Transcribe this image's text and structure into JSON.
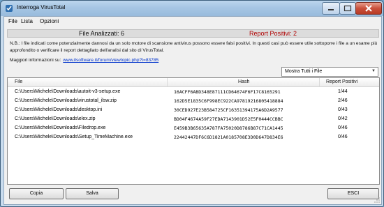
{
  "window": {
    "title": "Interroga VirusTotal"
  },
  "menu": [
    "File",
    "Lista",
    "Opzioni"
  ],
  "summary": {
    "analyzed": "File Analizzati: 6",
    "positive": "Report Positivi: 2"
  },
  "note": "N.B.: I file indicati come potenzialmente dannosi da un solo motore di scansione antivirus possono essere falsi positivi. In questi casi può essere utile sottoporre i file a un esame più approfondito o verificare il report dettagliato dell'analisi dal sito di VirusTotal.",
  "more_info": {
    "label": "Maggiori informazioni su:",
    "link": "www.ilsoftware.it/forum/viewtopic.php?t=83785"
  },
  "filter": {
    "selected": "Mostra Tutti i File"
  },
  "table": {
    "headers": [
      "File",
      "Hash",
      "Report Positivi"
    ],
    "rows": [
      {
        "file": "C:\\Users\\Michele\\Downloads\\autoit-v3-setup.exe",
        "hash": "16ACFF6ABD348E87111CD64674F6F17C8165291",
        "report": "1/44"
      },
      {
        "file": "C:\\Users\\Michele\\Downloads\\virustotal_ilsw.zip",
        "hash": "162D5E1835C6F998EC922CA97819216805418884",
        "report": "2/46"
      },
      {
        "file": "C:\\Users\\Michele\\Downloads\\desktop.ini",
        "hash": "30CED927E23B584725CF16351394175A6D2A9577",
        "report": "0/43"
      },
      {
        "file": "C:\\Users\\Michele\\Downloads\\elex.zip",
        "hash": "BD04F4674A59F27EDA7143901D52E5F0444CCBBC",
        "report": "0/42"
      },
      {
        "file": "C:\\Users\\Michele\\Downloads\\Filedrop.exe",
        "hash": "E459B3B65635A787FA75020D8786B87C71CA1445",
        "report": "0/46"
      },
      {
        "file": "C:\\Users\\Michele\\Downloads\\Setup_TimeMachine.exe",
        "hash": "22442447DF6C6D1821A0185708E3D0D647D834E6",
        "report": "0/46"
      }
    ]
  },
  "buttons": {
    "copy": "Copia",
    "save": "Salva",
    "exit": "ESCI"
  },
  "colors": {
    "positive_text": "#b00000",
    "link": "#0033cc"
  }
}
